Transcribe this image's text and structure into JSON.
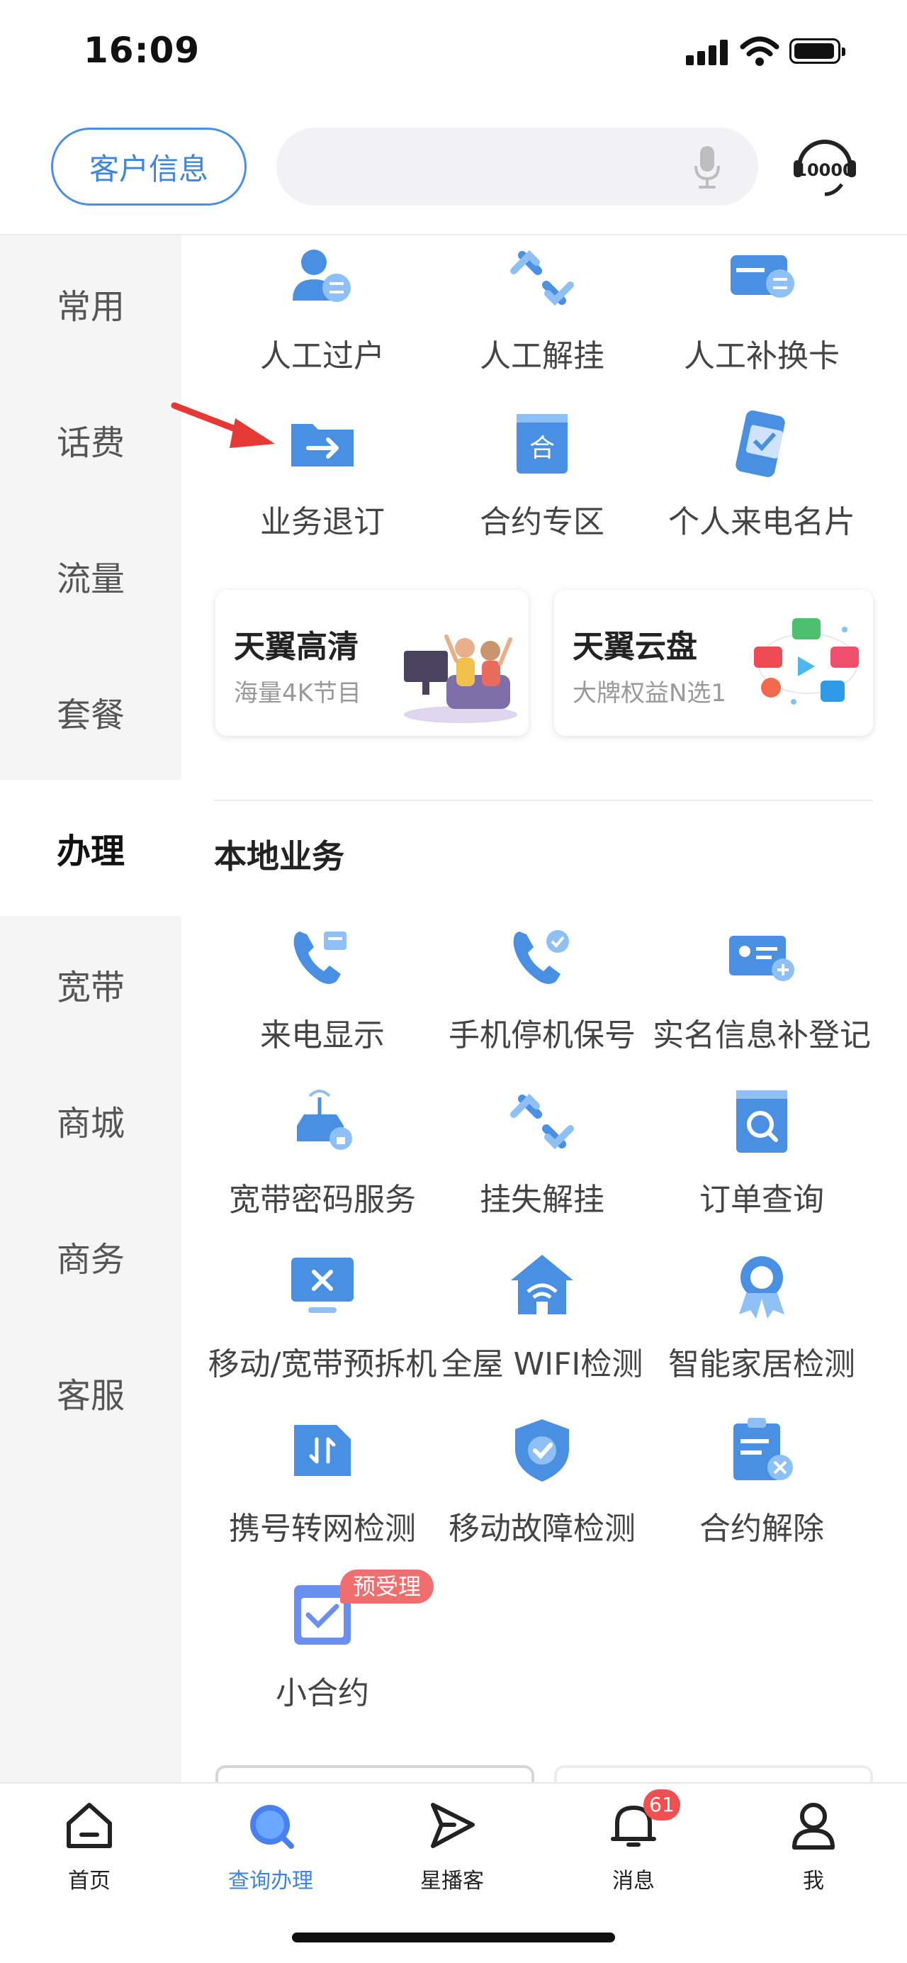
{
  "status": {
    "time": "16:09"
  },
  "header": {
    "customer_info": "客户信息",
    "search_placeholder": ""
  },
  "sidebar": {
    "items": [
      {
        "label": "常用"
      },
      {
        "label": "话费"
      },
      {
        "label": "流量"
      },
      {
        "label": "套餐"
      },
      {
        "label": "办理",
        "active": true
      },
      {
        "label": "宽带"
      },
      {
        "label": "商城"
      },
      {
        "label": "商务"
      },
      {
        "label": "客服"
      }
    ]
  },
  "top_grid": [
    {
      "label": "人工过户",
      "icon": "person-transfer-icon"
    },
    {
      "label": "人工解挂",
      "icon": "unlink-icon"
    },
    {
      "label": "人工补换卡",
      "icon": "card-swap-icon"
    },
    {
      "label": "业务退订",
      "icon": "folder-exit-icon"
    },
    {
      "label": "合约专区",
      "icon": "contract-book-icon"
    },
    {
      "label": "个人来电名片",
      "icon": "phone-card-icon"
    }
  ],
  "promo_cards": [
    {
      "title": "天翼高清",
      "subtitle": "海量4K节目"
    },
    {
      "title": "天翼云盘",
      "subtitle": "大牌权益N选1"
    }
  ],
  "local": {
    "title": "本地业务",
    "items": [
      {
        "label": "来电显示",
        "icon": "caller-id-icon"
      },
      {
        "label": "手机停机保号",
        "icon": "phone-hold-icon"
      },
      {
        "label": "实名信息补登记",
        "icon": "id-card-add-icon"
      },
      {
        "label": "宽带密码服务",
        "icon": "router-lock-icon"
      },
      {
        "label": "挂失解挂",
        "icon": "unlink-icon"
      },
      {
        "label": "订单查询",
        "icon": "order-search-icon"
      },
      {
        "label": "移动/宽带预拆机",
        "icon": "monitor-x-icon"
      },
      {
        "label": "全屋 WIFI检测",
        "icon": "home-wifi-icon"
      },
      {
        "label": "智能家居检测",
        "icon": "award-icon"
      },
      {
        "label": "携号转网检测",
        "icon": "sim-switch-icon"
      },
      {
        "label": "移动故障检测",
        "icon": "shield-check-icon"
      },
      {
        "label": "合约解除",
        "icon": "clipboard-x-icon"
      },
      {
        "label": "小合约",
        "icon": "mini-contract-icon",
        "badge": "预受理"
      }
    ]
  },
  "tabbar": {
    "items": [
      {
        "label": "首页",
        "icon": "home-icon"
      },
      {
        "label": "查询办理",
        "icon": "search-icon",
        "active": true
      },
      {
        "label": "星播客",
        "icon": "play-arrow-icon"
      },
      {
        "label": "消息",
        "icon": "bell-icon",
        "badge": "61"
      },
      {
        "label": "我",
        "icon": "user-icon"
      }
    ]
  },
  "colors": {
    "accent": "#3d86e0",
    "icon_blue": "#4a90e2",
    "badge_red": "#f0504f"
  }
}
